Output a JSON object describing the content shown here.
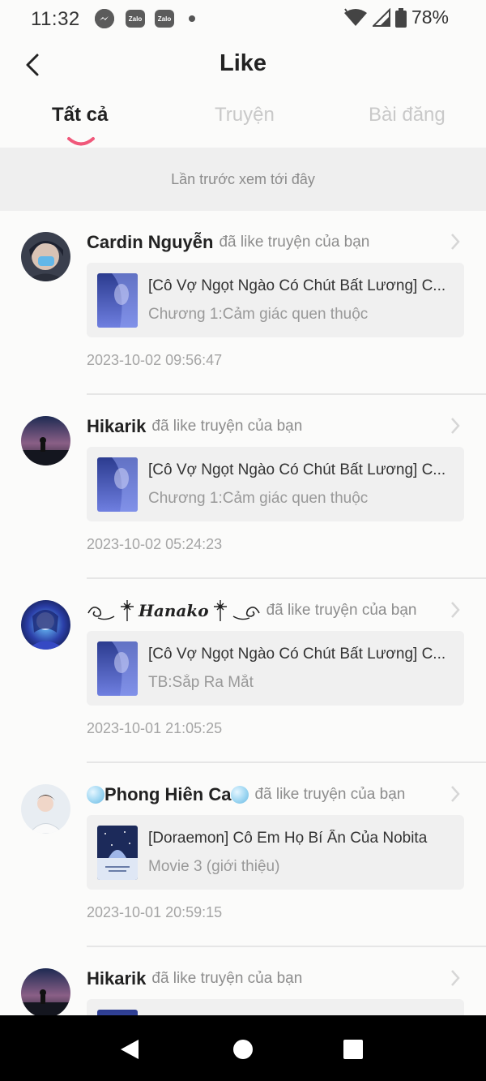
{
  "status_bar": {
    "time": "11:32",
    "apps": [
      "Zalo",
      "Zalo"
    ],
    "battery": "78%"
  },
  "header": {
    "title": "Like"
  },
  "tabs": [
    {
      "label": "Tất cả",
      "active": true
    },
    {
      "label": "Truyện",
      "active": false
    },
    {
      "label": "Bài đăng",
      "active": false
    }
  ],
  "notice": "Lần trước xem tới đây",
  "action_text": "đã like truyện của bạn",
  "accent_color": "#f0587a",
  "feed": [
    {
      "user": "Cardin Nguyễn",
      "title": "[Cô Vợ Ngọt Ngào Có Chút Bất Lương] C...",
      "subtitle": "Chương 1:Cảm giác quen thuộc",
      "timestamp": "2023-10-02 09:56:47"
    },
    {
      "user": "Hikarik",
      "title": "[Cô Vợ Ngọt Ngào Có Chút Bất Lương] C...",
      "subtitle": "Chương 1:Cảm giác quen thuộc",
      "timestamp": "2023-10-02 05:24:23"
    },
    {
      "user": "Hanako",
      "title": "[Cô Vợ Ngọt Ngào Có Chút Bất Lương] C...",
      "subtitle": "TB:Sắp Ra Mắt",
      "timestamp": "2023-10-01 21:05:25"
    },
    {
      "user": "Phong Hiên Ca",
      "title": "[Doraemon] Cô Em Họ Bí Ẩn Của Nobita",
      "subtitle": "Movie 3 (giới thiệu)",
      "timestamp": "2023-10-01 20:59:15"
    },
    {
      "user": "Hikarik"
    }
  ]
}
